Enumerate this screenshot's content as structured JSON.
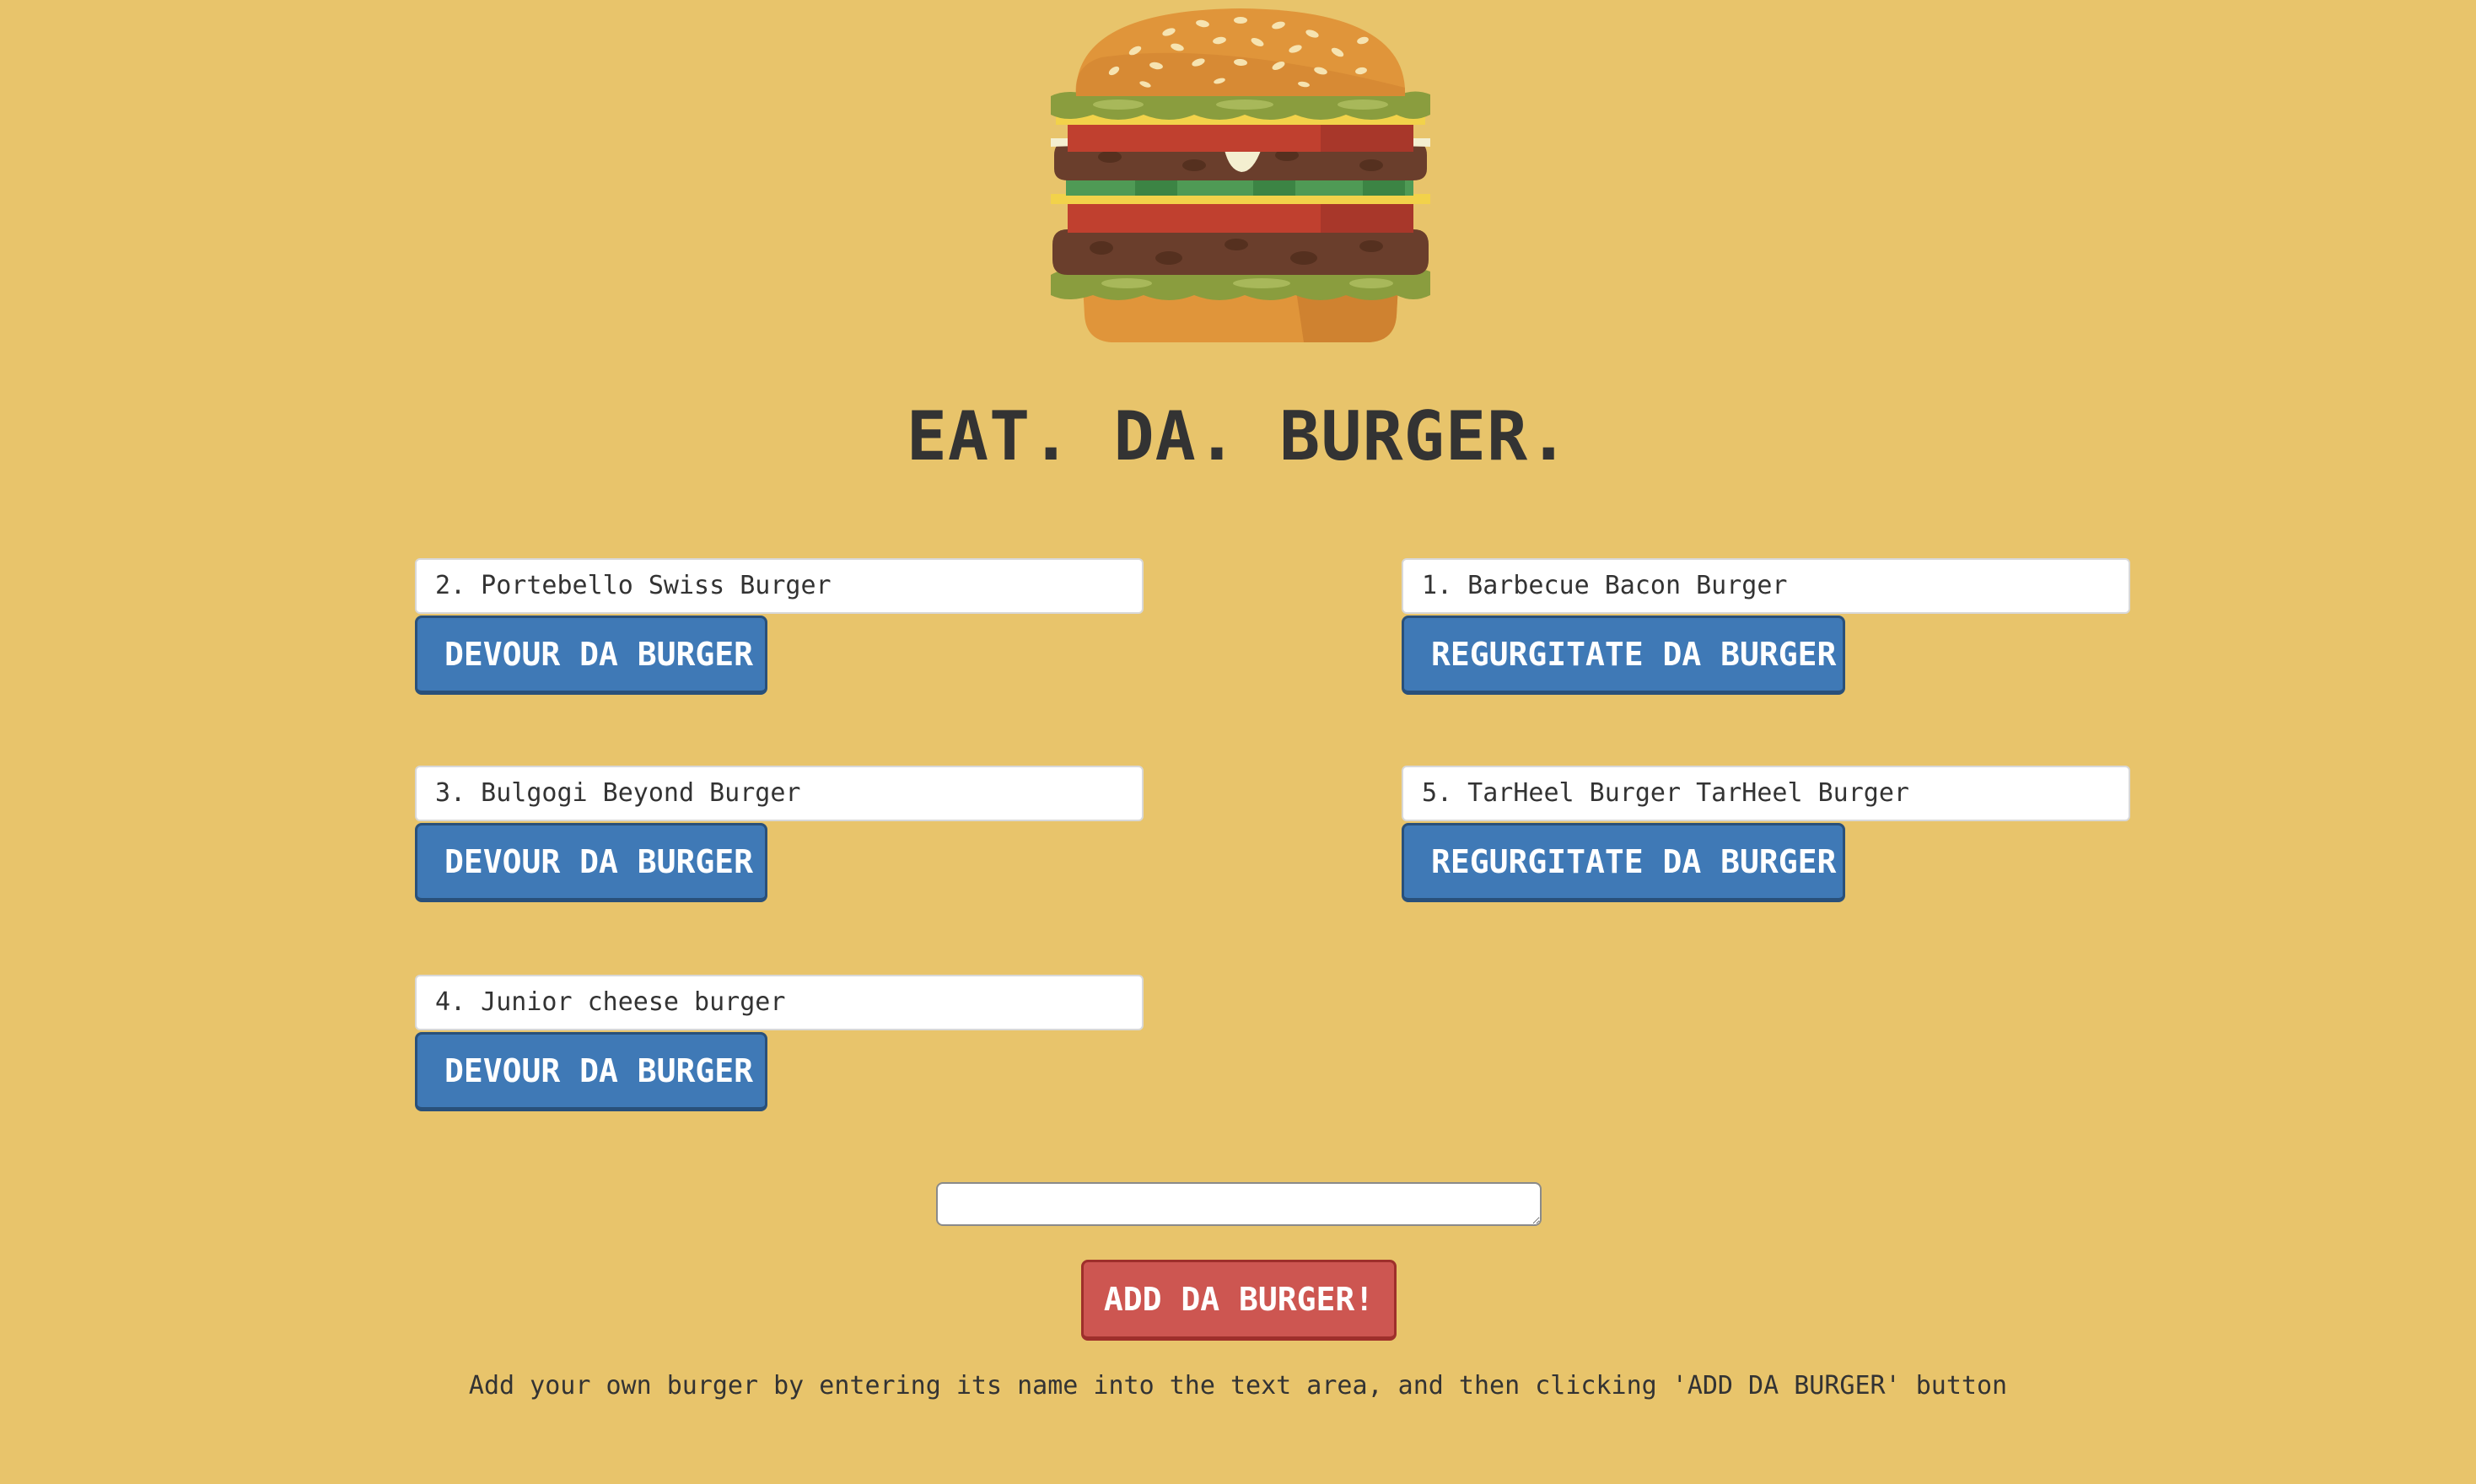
{
  "header": {
    "title": "EAT. DA. BURGER.",
    "logo_icon": "hamburger-icon"
  },
  "not_devoured": [
    {
      "name": "2. Portebello Swiss Burger",
      "button_label": "DEVOUR DA BURGER"
    },
    {
      "name": "3. Bulgogi Beyond Burger",
      "button_label": "DEVOUR DA BURGER"
    },
    {
      "name": "4. Junior cheese burger",
      "button_label": "DEVOUR DA BURGER"
    }
  ],
  "devoured": [
    {
      "name": "1. Barbecue Bacon Burger",
      "button_label": "REGURGITATE DA BURGER"
    },
    {
      "name": "5. TarHeel Burger TarHeel Burger",
      "button_label": "REGURGITATE DA BURGER"
    }
  ],
  "add_form": {
    "input_value": "",
    "button_label": "ADD DA BURGER!",
    "instructions": "Add your own burger by entering its name into the text area, and then clicking 'ADD DA BURGER' button"
  },
  "colors": {
    "background": "#e8c46b",
    "devour_button": "#3f79b6",
    "add_button": "#cd5651",
    "text": "#333333"
  }
}
